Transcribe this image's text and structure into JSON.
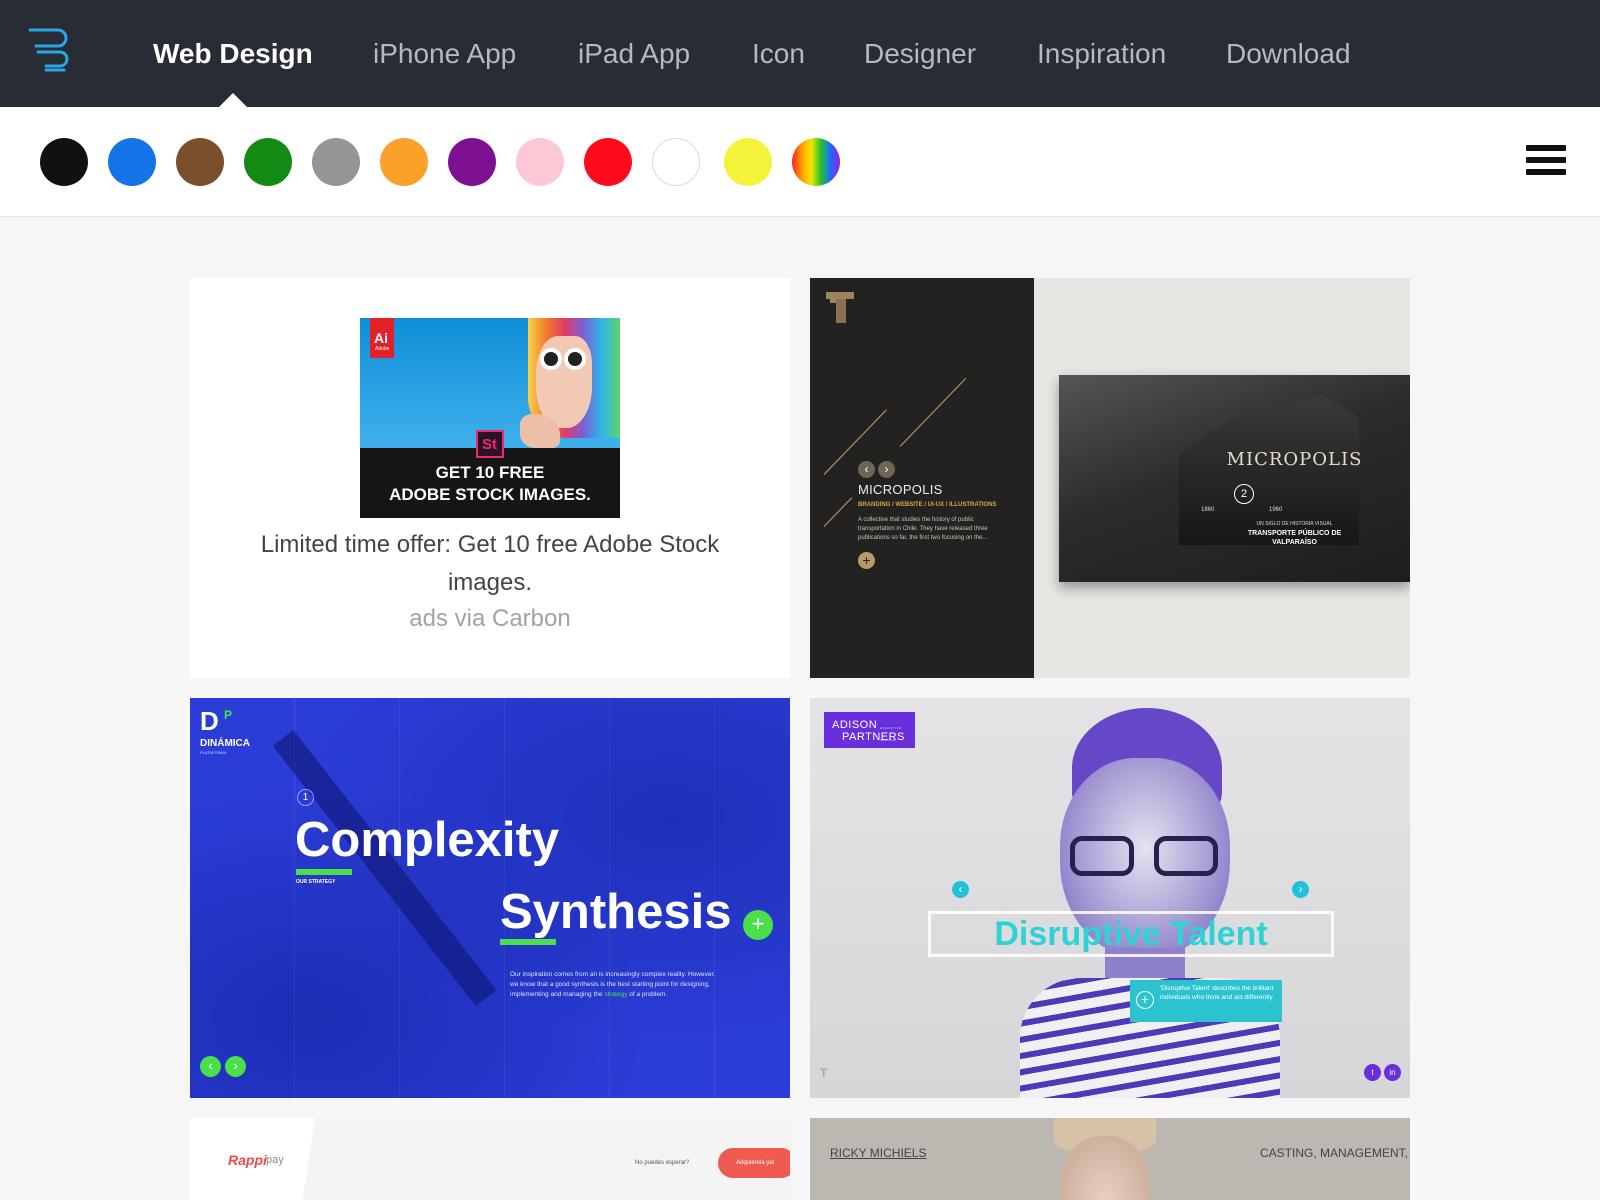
{
  "nav": {
    "items": [
      {
        "label": "Web Design",
        "active": true
      },
      {
        "label": "iPhone App",
        "active": false
      },
      {
        "label": "iPad App",
        "active": false
      },
      {
        "label": "Icon",
        "active": false
      },
      {
        "label": "Designer",
        "active": false
      },
      {
        "label": "Inspiration",
        "active": false
      },
      {
        "label": "Download",
        "active": false
      }
    ],
    "logo_icon": "wind-lines-logo-icon",
    "colors": {
      "bar": "#272c35",
      "active": "#ffffff",
      "inactive": "#b6b9bf",
      "logo": "#2aa7e6"
    }
  },
  "color_filter": {
    "swatches": [
      "#111111",
      "#1473e6",
      "#7b4f2a",
      "#138a13",
      "#959595",
      "#fca02c",
      "#7d1192",
      "#fdc8d6",
      "#ff0c1c",
      "#ffffff",
      "#f5f23c",
      "rainbow"
    ],
    "menu_icon": "hamburger-menu-icon"
  },
  "ad": {
    "brand_logo": "Ai",
    "brand_sub": "Adobe",
    "product_badge": "St",
    "image_headline_1": "GET 10 FREE",
    "image_headline_2": "ADOBE STOCK IMAGES.",
    "text": "Limited time offer: Get 10 free Adobe Stock images.",
    "via": "ads via Carbon"
  },
  "cards": {
    "micropolis": {
      "logo": "T",
      "title": "MICROPOLIS",
      "subtitle": "BRANDING / WEBSITE / UI-UX / ILLUSTRATIONS",
      "description": "A collective that studies the history of public transportation in Chile. They have released three publications so far, the first two focusing on the...",
      "photo_title": "MICROPOLIS",
      "photo_number": "2",
      "year_start": "1860",
      "year_end": "1960",
      "photo_caption": "UN SIGLO DE HISTORIA VISUAL",
      "photo_caption_bold_1": "TRANSPORTE PÚBLICO DE",
      "photo_caption_bold_2": "VALPARAÍSO"
    },
    "dinamica": {
      "logo_letter": "D",
      "logo_p": "P",
      "brand": "DINÁMICA",
      "brand_sub": "PLATAFORMA",
      "step": "1",
      "heading_1": "Complexity",
      "label": "OUR STRATEGY",
      "heading_2": "Synthesis",
      "body_1": "Our inspiration comes from an is increasingly complex reality. However, we know that a good synthesis is the best starting point for designing, implementing and managing the",
      "body_highlight": "strategy",
      "body_2": "of a problem.",
      "accent": "#4be04b"
    },
    "adison": {
      "logo_1": "ADISON",
      "logo_2": "PARTNERS",
      "logo_small": "EXECUTIVE SEARCH",
      "title": "Disruptive Talent",
      "info": "'Disruptive Talent' describes the brilliant individuals who think and act differently",
      "corner_logo": "T",
      "accent": "#2ed3d6"
    },
    "rappi": {
      "logo": "Rappi",
      "pay": "pay",
      "question": "No puedes esperar?",
      "button": "Adquiérela ya!"
    },
    "ricky": {
      "name": "RICKY MICHIELS",
      "tagline": "CASTING, MANAGEMENT, IN"
    }
  }
}
